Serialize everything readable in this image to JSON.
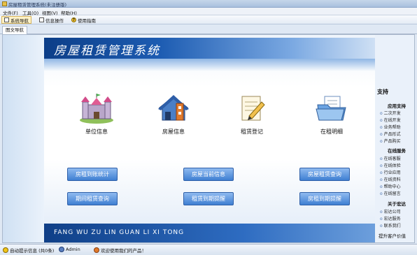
{
  "window": {
    "title": "房屋租赁管理系统(未注册版)"
  },
  "menu": [
    "文件(F)",
    "工具(O)",
    "视图(V)",
    "帮助(H)"
  ],
  "toolbar": {
    "items": [
      "系统导航",
      "信息操作",
      "使用指南"
    ]
  },
  "tab": {
    "label": "图文导航"
  },
  "banner": {
    "title": "房屋租赁管理系统"
  },
  "icons": [
    {
      "label": "单位信息",
      "icon": "castle-icon"
    },
    {
      "label": "房屋信息",
      "icon": "house-icon"
    },
    {
      "label": "租赁登记",
      "icon": "notepad-pencil-icon"
    },
    {
      "label": "在租明细",
      "icon": "folder-documents-icon"
    }
  ],
  "buttons": {
    "row1": [
      "房租到账统计",
      "房屋当前信息",
      "房屋租赁查询"
    ],
    "row2": [
      "期间租赁查询",
      "租赁到期提醒",
      "房租到期提醒"
    ]
  },
  "footer": {
    "text": "FANG WU ZU LIN GUAN LI XI TONG"
  },
  "sidebar": {
    "heading": "支持",
    "groups": [
      {
        "title": "应用支持",
        "items": [
          "二次开发",
          "在线开发",
          "业务帮助",
          "产品形式",
          "产品购买"
        ]
      },
      {
        "title": "在线服务",
        "items": [
          "在线客服",
          "在线体验",
          "行业应用",
          "在线资料",
          "帮助中心",
          "在线留言"
        ]
      },
      {
        "title": "关于宏达",
        "items": [
          "宏达公司",
          "宏达服务",
          "联系我们"
        ]
      }
    ],
    "footer": "提升客户价值"
  },
  "status": {
    "items": [
      "自动提示信息 (共0条)",
      "Admin",
      "欢迎使用我们的产品！"
    ]
  }
}
